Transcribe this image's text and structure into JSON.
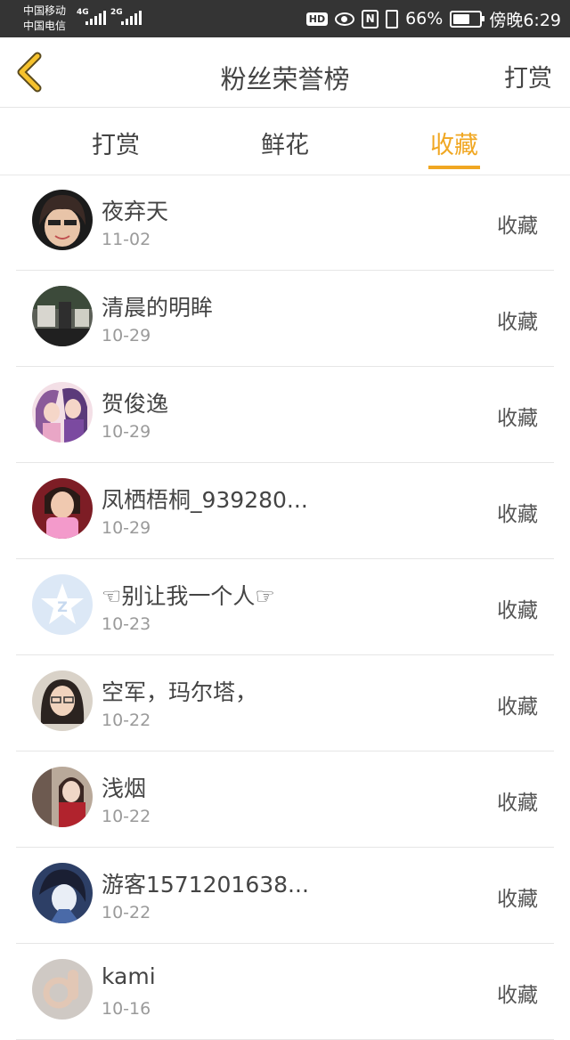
{
  "status_bar": {
    "carrier_1": "中国移动",
    "carrier_2": "中国电信",
    "network_1": "4G",
    "network_2": "2G",
    "hd_label": "HD",
    "nfc_label": "N",
    "battery_text": "66%",
    "battery_level": 0.66,
    "time": "傍晚6:29"
  },
  "header": {
    "back_icon": "chevron-left-icon",
    "title": "粉丝荣誉榜",
    "action_label": "打赏",
    "accent_color": "#f0a722"
  },
  "tabs": [
    {
      "label": "打赏",
      "active": false
    },
    {
      "label": "鲜花",
      "active": false
    },
    {
      "label": "收藏",
      "active": true
    }
  ],
  "fans": [
    {
      "name": "夜弃天",
      "date": "11-02",
      "type": "收藏"
    },
    {
      "name": "清晨的明眸",
      "date": "10-29",
      "type": "收藏"
    },
    {
      "name": "贺俊逸",
      "date": "10-29",
      "type": "收藏"
    },
    {
      "name": "凤栖梧桐_939280...",
      "date": "10-29",
      "type": "收藏"
    },
    {
      "name": "☜别让我一个人☞",
      "date": "10-23",
      "type": "收藏"
    },
    {
      "name": "空军，玛尔塔，",
      "date": "10-22",
      "type": "收藏"
    },
    {
      "name": "浅烟",
      "date": "10-22",
      "type": "收藏"
    },
    {
      "name": "游客1571201638...",
      "date": "10-22",
      "type": "收藏"
    },
    {
      "name": "kami",
      "date": "10-16",
      "type": "收藏"
    }
  ]
}
